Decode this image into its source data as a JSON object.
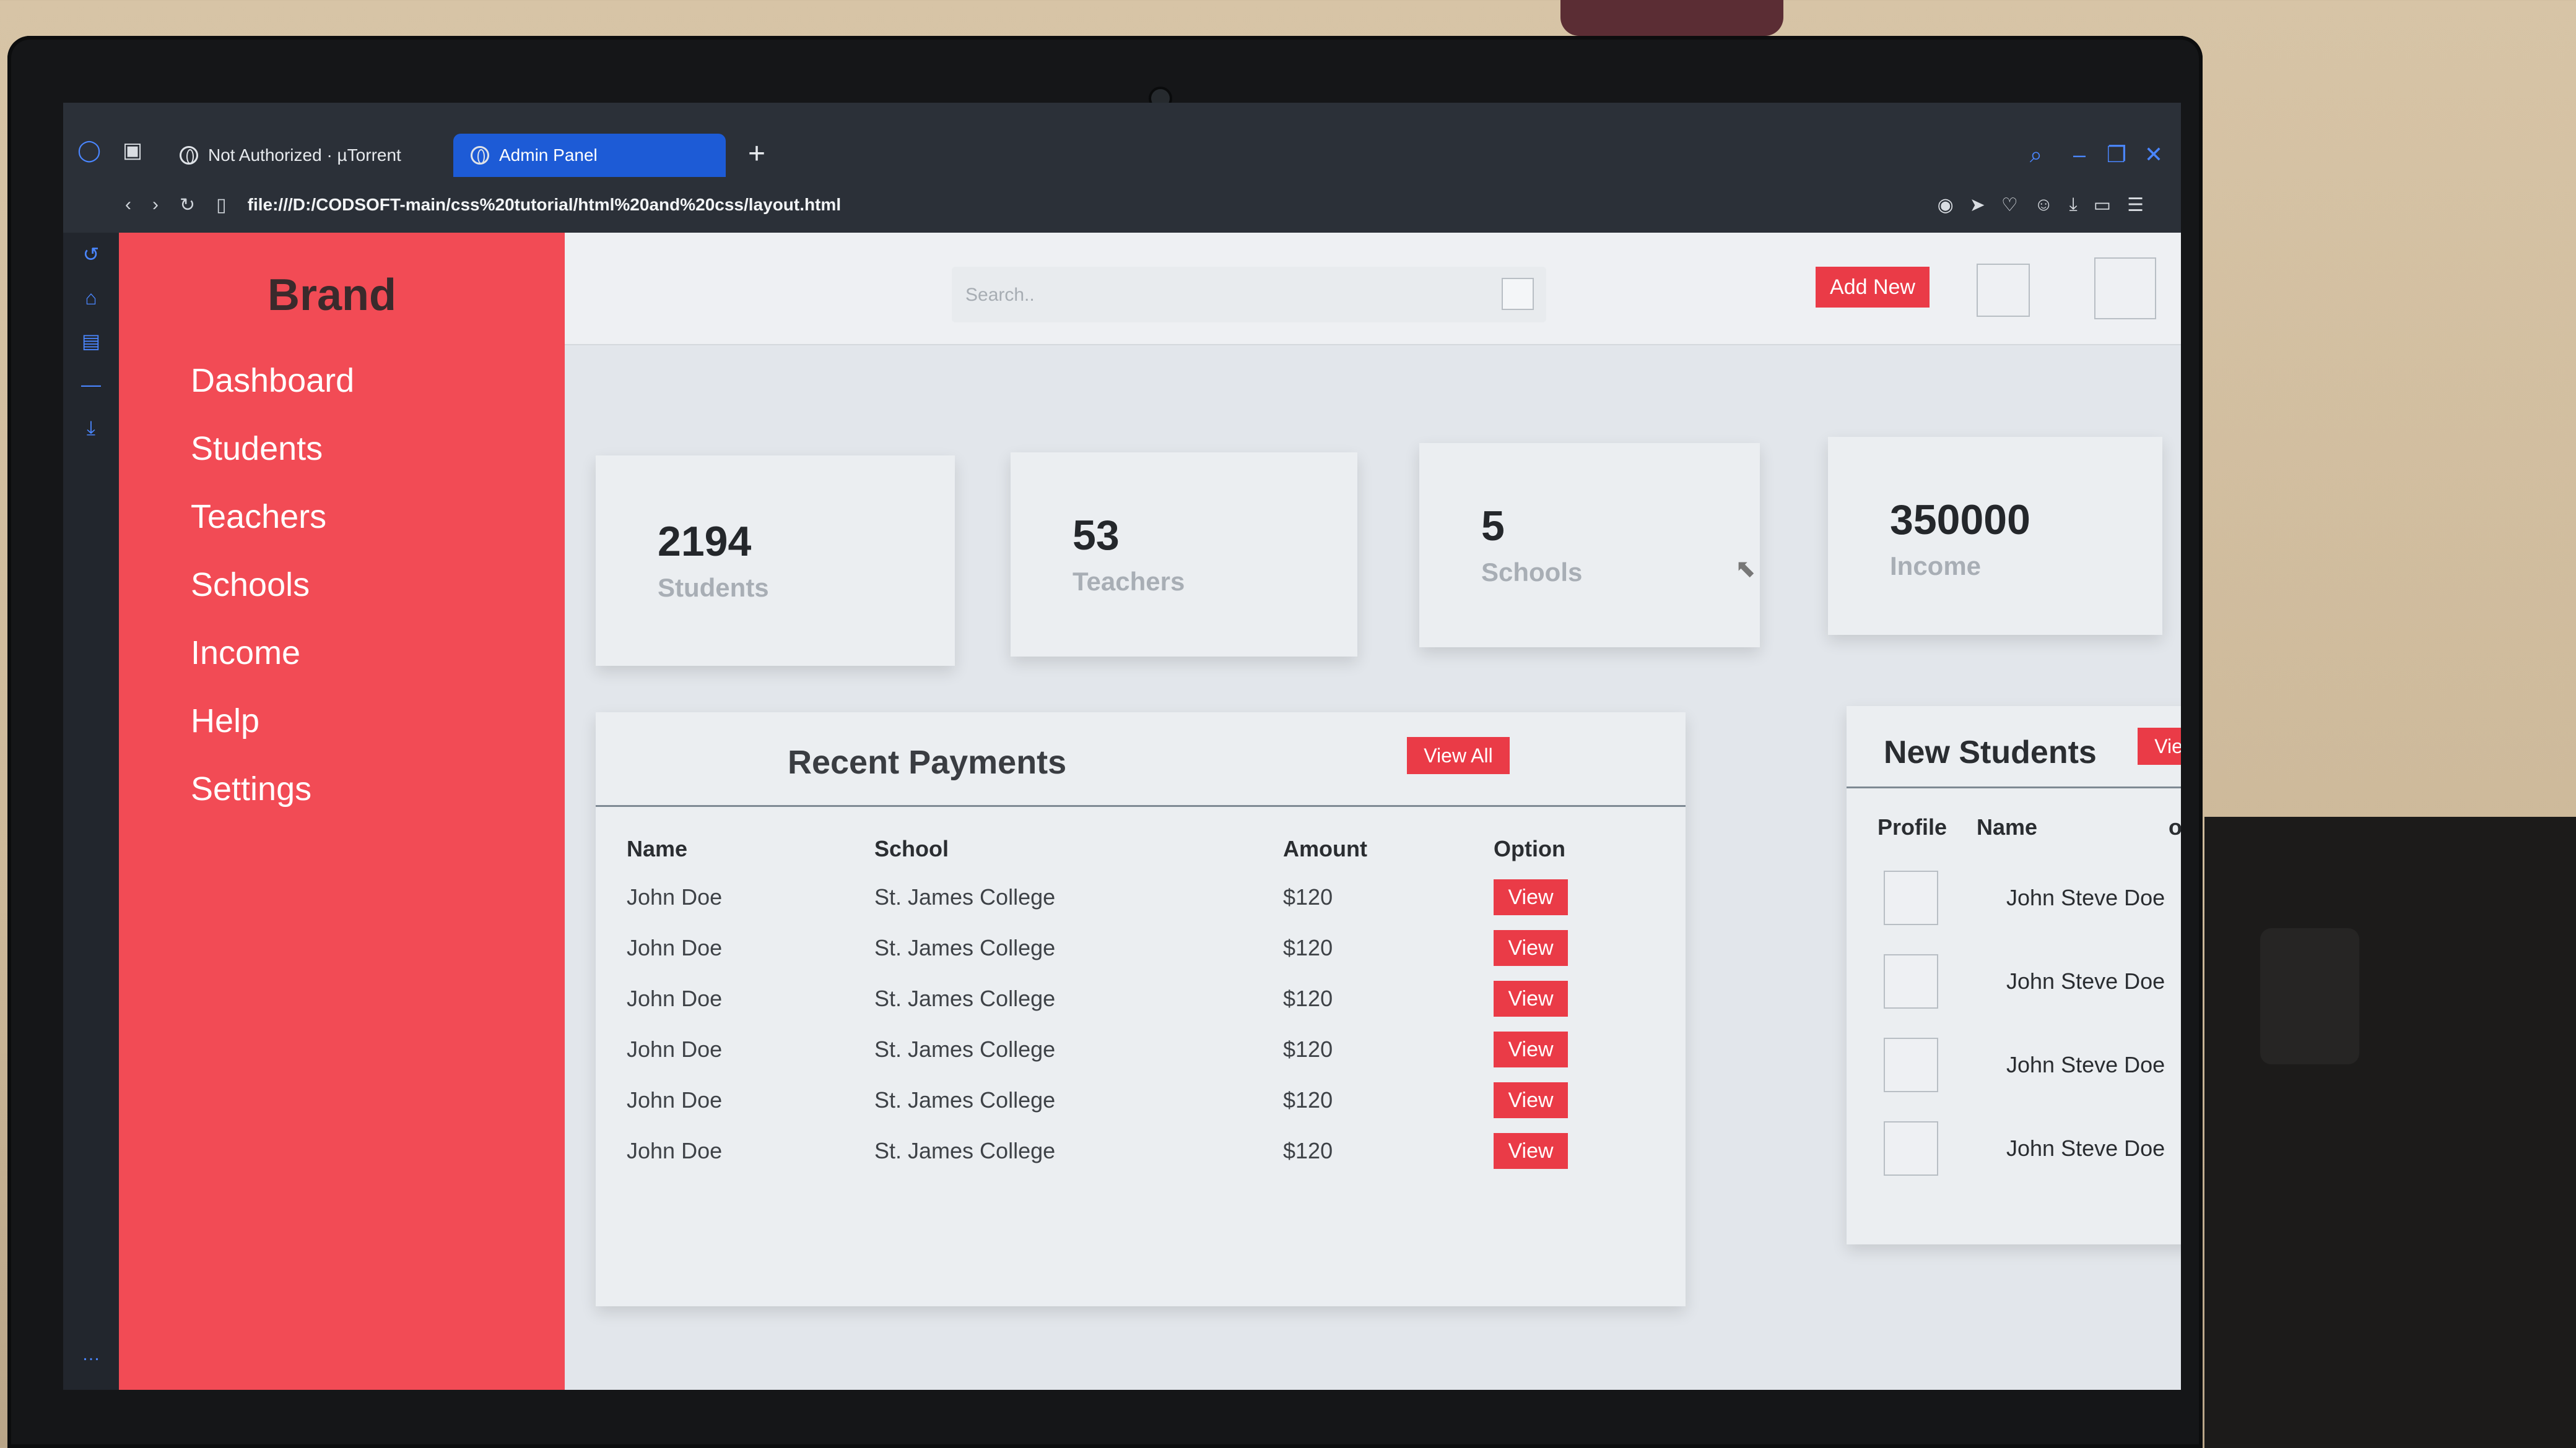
{
  "browser": {
    "tabs": [
      {
        "label": "Not Authorized · µTorrent"
      },
      {
        "label": "Admin Panel"
      }
    ],
    "url": "file:///D:/CODSOFT-main/css%20tutorial/html%20and%20css/layout.html"
  },
  "sidebar": {
    "brand": "Brand",
    "items": [
      {
        "label": "Dashboard"
      },
      {
        "label": "Students"
      },
      {
        "label": "Teachers"
      },
      {
        "label": "Schools"
      },
      {
        "label": "Income"
      },
      {
        "label": "Help"
      },
      {
        "label": "Settings"
      }
    ]
  },
  "topbar": {
    "search_placeholder": "Search..",
    "add_new_label": "Add New"
  },
  "stats": [
    {
      "value": "2194",
      "label": "Students"
    },
    {
      "value": "53",
      "label": "Teachers"
    },
    {
      "value": "5",
      "label": "Schools"
    },
    {
      "value": "350000",
      "label": "Income"
    }
  ],
  "recent_payments": {
    "title": "Recent Payments",
    "view_all_label": "View All",
    "headers": [
      "Name",
      "School",
      "Amount",
      "Option"
    ],
    "rows": [
      {
        "name": "John Doe",
        "school": "St. James College",
        "amount": "$120",
        "option": "View"
      },
      {
        "name": "John Doe",
        "school": "St. James College",
        "amount": "$120",
        "option": "View"
      },
      {
        "name": "John Doe",
        "school": "St. James College",
        "amount": "$120",
        "option": "View"
      },
      {
        "name": "John Doe",
        "school": "St. James College",
        "amount": "$120",
        "option": "View"
      },
      {
        "name": "John Doe",
        "school": "St. James College",
        "amount": "$120",
        "option": "View"
      },
      {
        "name": "John Doe",
        "school": "St. James College",
        "amount": "$120",
        "option": "View"
      }
    ]
  },
  "new_students": {
    "title": "New Students",
    "view_all_label": "View All",
    "headers": [
      "Profile",
      "Name",
      "option"
    ],
    "rows": [
      {
        "name": "John Steve Doe"
      },
      {
        "name": "John Steve Doe"
      },
      {
        "name": "John Steve Doe"
      },
      {
        "name": "John Steve Doe"
      }
    ]
  },
  "colors": {
    "accent_red": "#f24b55",
    "button_red": "#ea3b47",
    "browser_tab_active": "#1d5bd6"
  }
}
